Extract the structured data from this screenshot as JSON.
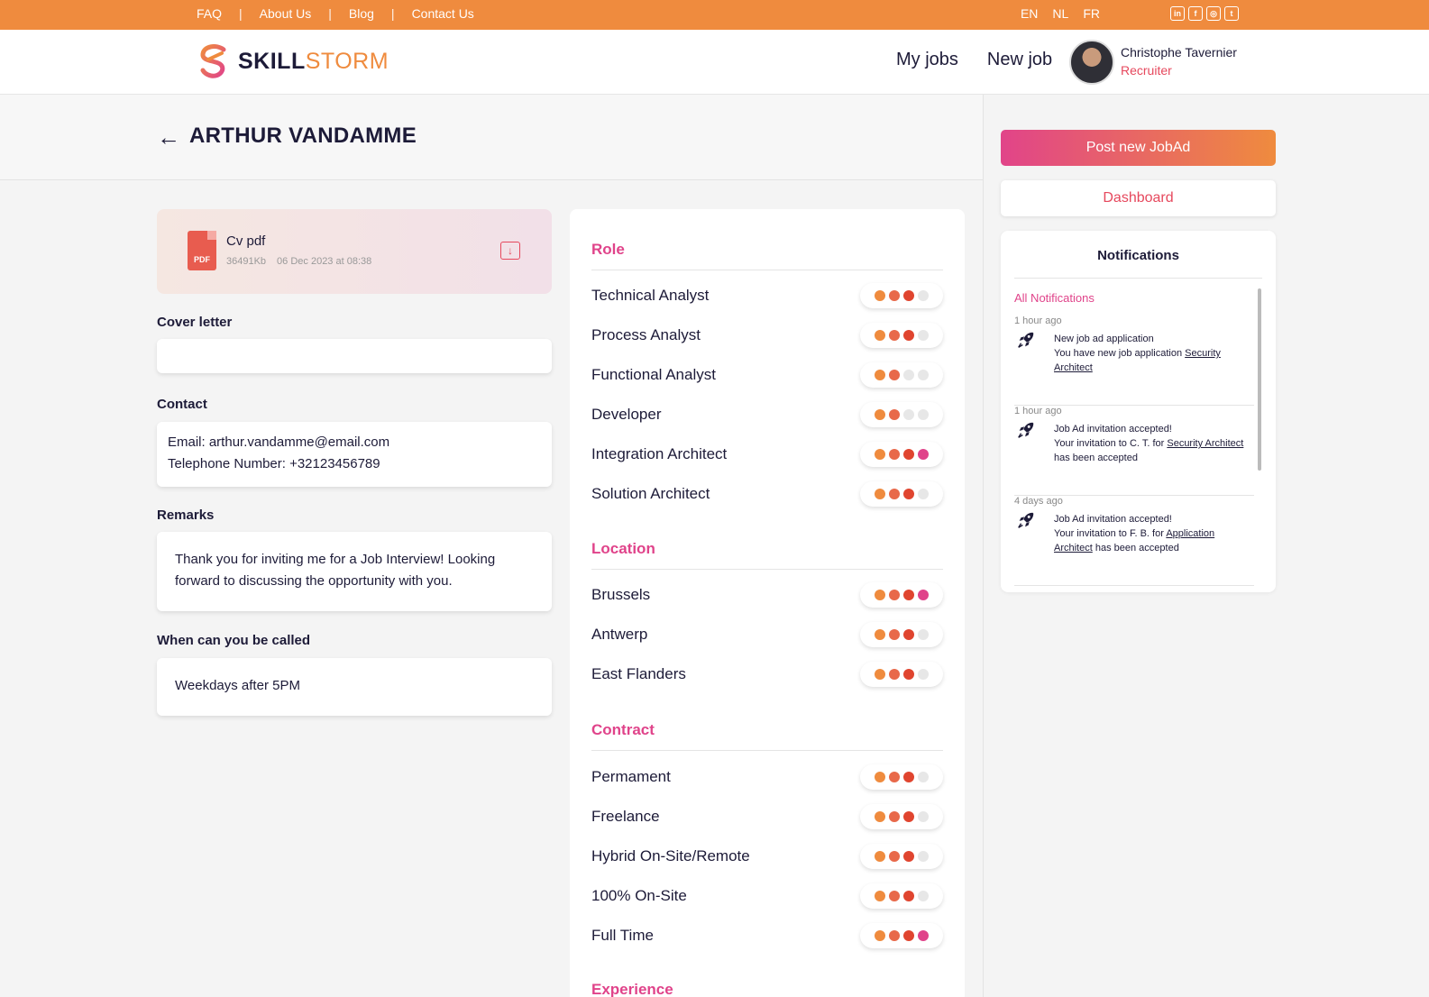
{
  "topbar": {
    "links": [
      "FAQ",
      "About Us",
      "Blog",
      "Contact Us"
    ],
    "separator": "|",
    "languages": [
      "EN",
      "NL",
      "FR"
    ],
    "socials": [
      "linkedin-icon",
      "facebook-icon",
      "instagram-icon",
      "twitter-icon"
    ],
    "social_glyphs": [
      "in",
      "f",
      "◎",
      "t"
    ]
  },
  "header": {
    "logo_skill": "SKILL",
    "logo_storm": "STORM",
    "nav": [
      "My jobs",
      "New job"
    ],
    "user_name": "Christophe Tavernier",
    "user_role": "Recruiter"
  },
  "page": {
    "back_arrow": "←",
    "title": "ARTHUR VANDAMME"
  },
  "cv": {
    "name": "Cv pdf",
    "size": "36491Kb",
    "date": "06 Dec 2023 at 08:38",
    "badge": "PDF",
    "download_glyph": "↓"
  },
  "sections": {
    "cover_label": "Cover letter",
    "cover_value": "",
    "contact_label": "Contact",
    "contact_email": "Email: arthur.vandamme@email.com",
    "contact_phone": "Telephone Number: +32123456789",
    "remarks_label": "Remarks",
    "remarks_value": "Thank you for inviting me for a Job Interview! Looking forward to discussing the opportunity with you.",
    "call_label": "When can you be called",
    "call_value": "Weekdays after 5PM"
  },
  "skills": {
    "role_title": "Role",
    "role": [
      {
        "name": "Technical Analyst",
        "level": 3
      },
      {
        "name": "Process Analyst",
        "level": 3
      },
      {
        "name": "Functional Analyst",
        "level": 2
      },
      {
        "name": "Developer",
        "level": 2
      },
      {
        "name": "Integration Architect",
        "level": 4
      },
      {
        "name": "Solution Architect",
        "level": 3
      }
    ],
    "location_title": "Location",
    "location": [
      {
        "name": "Brussels",
        "level": 4
      },
      {
        "name": "Antwerp",
        "level": 3
      },
      {
        "name": "East Flanders",
        "level": 3
      }
    ],
    "contract_title": "Contract",
    "contract": [
      {
        "name": "Permament",
        "level": 3
      },
      {
        "name": "Freelance",
        "level": 3
      },
      {
        "name": "Hybrid On-Site/Remote",
        "level": 3
      },
      {
        "name": "100% On-Site",
        "level": 3
      },
      {
        "name": "Full Time",
        "level": 4
      }
    ],
    "experience_title": "Experience",
    "dot_colors": [
      "#ef8b3e",
      "#e8694a",
      "#e0452f",
      "#e0438a"
    ],
    "empty_color": "#e7e7e7"
  },
  "sidebar": {
    "post_label": "Post new JobAd",
    "dashboard_label": "Dashboard",
    "notifications_title": "Notifications",
    "all_notifications": "All Notifications",
    "items": [
      {
        "time": "1 hour ago",
        "line1": "New job ad application",
        "line2": "You have new job application ",
        "link": "Security Architect",
        "tail": ""
      },
      {
        "time": "1 hour ago",
        "line1": "Job Ad invitation accepted!",
        "line2": "Your invitation to C. T. for ",
        "link": "Security Architect",
        "tail": " has been accepted"
      },
      {
        "time": "4 days ago",
        "line1": "Job Ad invitation accepted!",
        "line2": "Your invitation to F. B. for ",
        "link": "Application Architect",
        "tail": " has been accepted"
      }
    ]
  }
}
